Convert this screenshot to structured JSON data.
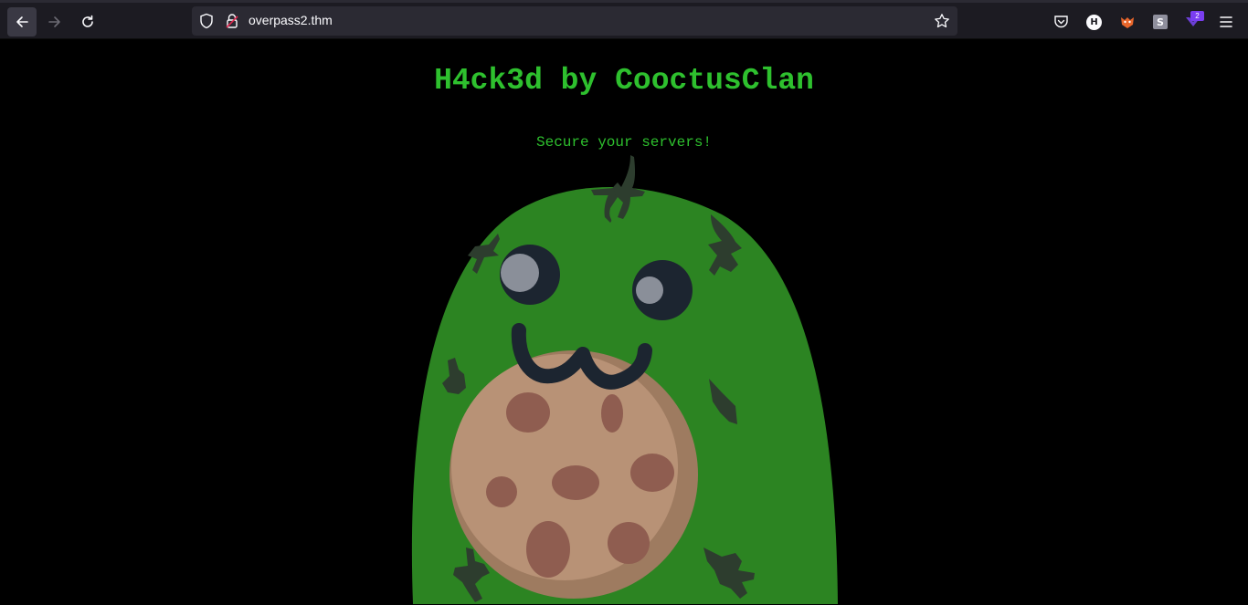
{
  "browser": {
    "url": "overpass2.thm",
    "extension_badge_count": "2",
    "profile_initial": "H",
    "ext_s_letter": "S"
  },
  "page": {
    "title": "H4ck3d by CooctusClan",
    "subtitle": "Secure your servers!",
    "mascot": "cooctus-holding-cookie-image"
  },
  "colors": {
    "text_accent": "#2ec02e",
    "background": "#000000",
    "mascot_body": "#2c8422",
    "cookie": "#b89276"
  }
}
